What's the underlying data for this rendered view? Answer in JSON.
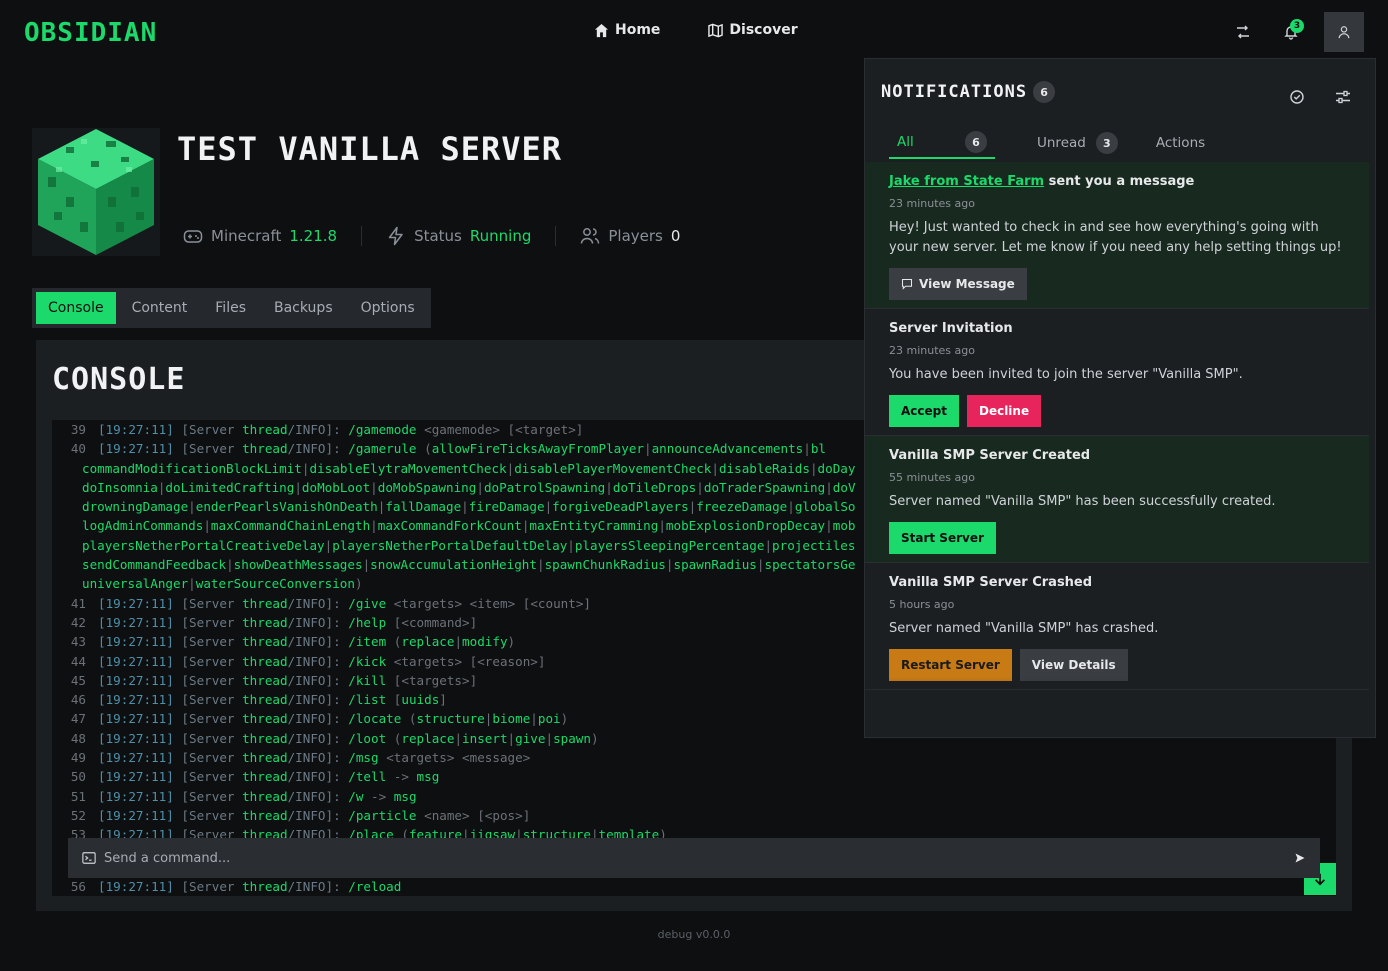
{
  "app": {
    "logo": "OBSIDIAN"
  },
  "nav": {
    "home": "Home",
    "discover": "Discover"
  },
  "topbar": {
    "notif_count": "3"
  },
  "server": {
    "title": "TEST VANILLA SERVER",
    "game_label": "Minecraft",
    "game_version": "1.21.8",
    "status_label": "Status",
    "status_value": "Running",
    "players_label": "Players",
    "players_value": "0"
  },
  "tabs": [
    "Console",
    "Content",
    "Files",
    "Backups",
    "Options"
  ],
  "console": {
    "title": "CONSOLE",
    "input_placeholder": "Send a command...",
    "lines": [
      {
        "n": "39",
        "ts": "[19:27:11]",
        "cmd": "/gamemode",
        "rest": " <gamemode> [<target>]"
      },
      {
        "n": "40",
        "ts": "[19:27:11]",
        "cmd": "/gamerule",
        "rest": " (allowFireTicksAwayFromPlayer|announceAdvancements|bl"
      }
    ],
    "cont_lines": [
      "commandModificationBlockLimit|disableElytraMovementCheck|disablePlayerMovementCheck|disableRaids|doDay",
      "doInsomnia|doLimitedCrafting|doMobLoot|doMobSpawning|doPatrolSpawning|doTileDrops|doTraderSpawning|doV",
      "drowningDamage|enderPearlsVanishOnDeath|fallDamage|fireDamage|forgiveDeadPlayers|freezeDamage|globalSo",
      "logAdminCommands|maxCommandChainLength|maxCommandForkCount|maxEntityCramming|mobExplosionDropDecay|mob",
      "playersNetherPortalCreativeDelay|playersNetherPortalDefaultDelay|playersSleepingPercentage|projectiles",
      "sendCommandFeedback|showDeathMessages|snowAccumulationHeight|spawnChunkRadius|spawnRadius|spectatorsGe",
      "universalAnger|waterSourceConversion)"
    ],
    "lines2": [
      {
        "n": "41",
        "ts": "[19:27:11]",
        "cmd": "/give",
        "rest": " <targets> <item> [<count>]"
      },
      {
        "n": "42",
        "ts": "[19:27:11]",
        "cmd": "/help",
        "rest": " [<command>]"
      },
      {
        "n": "43",
        "ts": "[19:27:11]",
        "cmd": "/item",
        "rest": " (replace|modify)"
      },
      {
        "n": "44",
        "ts": "[19:27:11]",
        "cmd": "/kick",
        "rest": " <targets> [<reason>]"
      },
      {
        "n": "45",
        "ts": "[19:27:11]",
        "cmd": "/kill",
        "rest": " [<targets>]"
      },
      {
        "n": "46",
        "ts": "[19:27:11]",
        "cmd": "/list",
        "rest": " [uuids]"
      },
      {
        "n": "47",
        "ts": "[19:27:11]",
        "cmd": "/locate",
        "rest": " (structure|biome|poi)"
      },
      {
        "n": "48",
        "ts": "[19:27:11]",
        "cmd": "/loot",
        "rest": " (replace|insert|give|spawn)"
      },
      {
        "n": "49",
        "ts": "[19:27:11]",
        "cmd": "/msg",
        "rest": " <targets> <message>"
      },
      {
        "n": "50",
        "ts": "[19:27:11]",
        "cmd": "/tell",
        "rest": " -> msg"
      },
      {
        "n": "51",
        "ts": "[19:27:11]",
        "cmd": "/w",
        "rest": " -> msg"
      },
      {
        "n": "52",
        "ts": "[19:27:11]",
        "cmd": "/particle",
        "rest": " <name> [<pos>]"
      },
      {
        "n": "53",
        "ts": "[19:27:11]",
        "cmd": "/place",
        "rest": " (feature|jigsaw|structure|template)"
      }
    ],
    "last_line": {
      "n": "56",
      "ts": "[19:27:11]",
      "cmd": "/reload",
      "rest": ""
    },
    "server_tag": "[Server ",
    "thread_tag": "thread",
    "info_tag": "/INFO]: "
  },
  "footer": {
    "text": "debug v0.0.0"
  },
  "notifications": {
    "title": "NOTIFICATIONS",
    "count": "6",
    "tabs": [
      {
        "label": "All",
        "count": "6"
      },
      {
        "label": "Unread",
        "count": "3"
      },
      {
        "label": "Actions",
        "count": ""
      }
    ],
    "items": [
      {
        "link": "Jake from State Farm",
        "title_rest": " sent you a message",
        "time": "23 minutes ago",
        "body": "Hey! Just wanted to check in and see how everything's going with your new server. Let me know if you need any help setting things up!",
        "btn1": "View Message"
      },
      {
        "title": "Server Invitation",
        "time": "23 minutes ago",
        "body": "You have been invited to join the server \"Vanilla SMP\".",
        "btn1": "Accept",
        "btn2": "Decline"
      },
      {
        "title": "Vanilla SMP Server Created",
        "time": "55 minutes ago",
        "body": "Server named \"Vanilla SMP\" has been successfully created.",
        "btn1": "Start Server"
      },
      {
        "title": "Vanilla SMP Server Crashed",
        "time": "5 hours ago",
        "body": "Server named \"Vanilla SMP\" has crashed.",
        "btn1": "Restart Server",
        "btn2": "View Details"
      }
    ]
  },
  "colors": {
    "accent": "#1bd96a",
    "danger": "#e8245c",
    "warning": "#c87a15",
    "bg": "#0e0f11",
    "card": "#1c1f22"
  }
}
